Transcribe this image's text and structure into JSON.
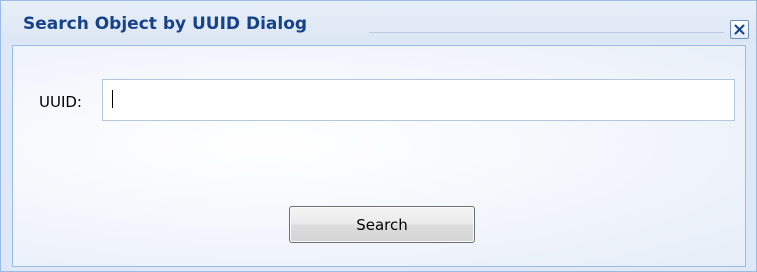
{
  "dialog": {
    "title": "Search Object by UUID Dialog",
    "close_icon": "close-x-icon"
  },
  "form": {
    "uuid_label": "UUID:",
    "uuid_value": "",
    "search_button_label": "Search"
  },
  "colors": {
    "title_text": "#15428b",
    "frame_border": "#99bbe8",
    "frame_background": "#dfe8f6"
  }
}
